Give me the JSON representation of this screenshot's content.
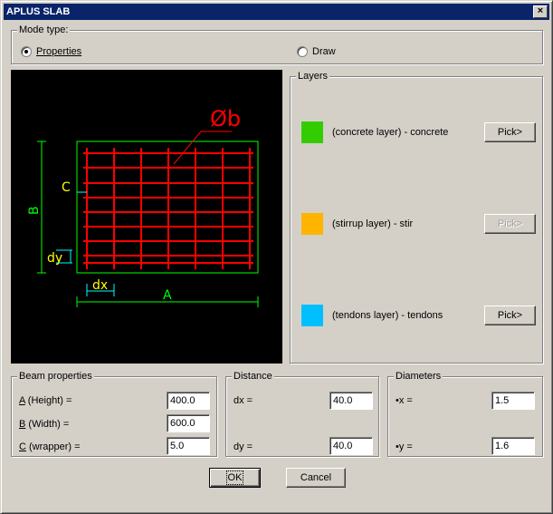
{
  "window": {
    "title": "APLUS SLAB",
    "close_glyph": "×"
  },
  "mode": {
    "legend": "Mode type:",
    "options": [
      {
        "label": "Properties",
        "selected": true
      },
      {
        "label": "Draw",
        "selected": false
      }
    ]
  },
  "preview": {
    "bar_label": "Øb",
    "cover_label": "C",
    "height_label": "B",
    "dy_label": "dy",
    "dx_label": "dx",
    "width_label": "A"
  },
  "layers": {
    "legend": "Layers",
    "items": [
      {
        "label": "(concrete layer) - concrete",
        "color": "#33cc00",
        "button": "Pick>",
        "enabled": true
      },
      {
        "label": "(stirrup layer) - stir",
        "color": "#ffb400",
        "button": "Pick>",
        "enabled": false
      },
      {
        "label": "(tendons layer) - tendons",
        "color": "#00bfff",
        "button": "Pick>",
        "enabled": true
      }
    ]
  },
  "beam": {
    "legend": "Beam properties",
    "height_label_key": "A",
    "height_label_rest": " (Height) =",
    "height_value": "400.0",
    "width_label_key": "B",
    "width_label_rest": " (Width) =",
    "width_value": "600.0",
    "wrapper_label_key": "C",
    "wrapper_label_rest": " (wrapper) =",
    "wrapper_value": "5.0"
  },
  "distance": {
    "legend": "Distance",
    "dx_label": "dx =",
    "dx_value": "40.0",
    "dy_label": "dy =",
    "dy_value": "40.0"
  },
  "diameters": {
    "legend": "Diameters",
    "x_label": "•x =",
    "x_value": "1.5",
    "y_label": "•y =",
    "y_value": "1.6"
  },
  "buttons": {
    "ok": "OK",
    "cancel": "Cancel"
  },
  "colors": {
    "drawing_red": "#ff0000",
    "drawing_green": "#00ff00",
    "drawing_yellow": "#ffff00",
    "drawing_cyan": "#00ffff",
    "titlebar": "#0a246a"
  }
}
